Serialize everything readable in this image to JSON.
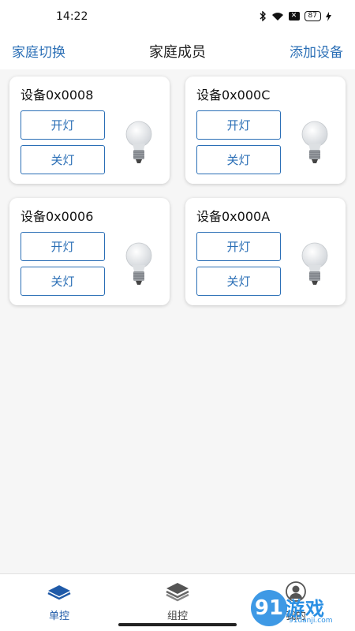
{
  "status_bar": {
    "time": "14:22",
    "battery": "87",
    "icons": [
      "bluetooth-icon",
      "wifi-icon",
      "sim-x-icon",
      "battery-icon",
      "charging-icon"
    ]
  },
  "header": {
    "left_action": "家庭切换",
    "title": "家庭成员",
    "right_action": "添加设备"
  },
  "devices": [
    {
      "name": "设备0x0008",
      "on_label": "开灯",
      "off_label": "关灯",
      "icon": "light-bulb-icon"
    },
    {
      "name": "设备0x000C",
      "on_label": "开灯",
      "off_label": "关灯",
      "icon": "light-bulb-icon"
    },
    {
      "name": "设备0x0006",
      "on_label": "开灯",
      "off_label": "关灯",
      "icon": "light-bulb-icon"
    },
    {
      "name": "设备0x000A",
      "on_label": "开灯",
      "off_label": "关灯",
      "icon": "light-bulb-icon"
    }
  ],
  "tabbar": {
    "tabs": [
      {
        "label": "单控",
        "icon": "layer-icon",
        "active": true
      },
      {
        "label": "组控",
        "icon": "layers-stack-icon",
        "active": false
      },
      {
        "label": "我的",
        "icon": "user-icon",
        "active": false
      }
    ]
  },
  "watermark": {
    "logo": "91",
    "text": "游戏",
    "url": "91danji.com"
  },
  "colors": {
    "accent": "#2b6fb6",
    "active_tab": "#1f5aa8",
    "background": "#f6f6f6",
    "watermark": "#2a8fe3"
  }
}
